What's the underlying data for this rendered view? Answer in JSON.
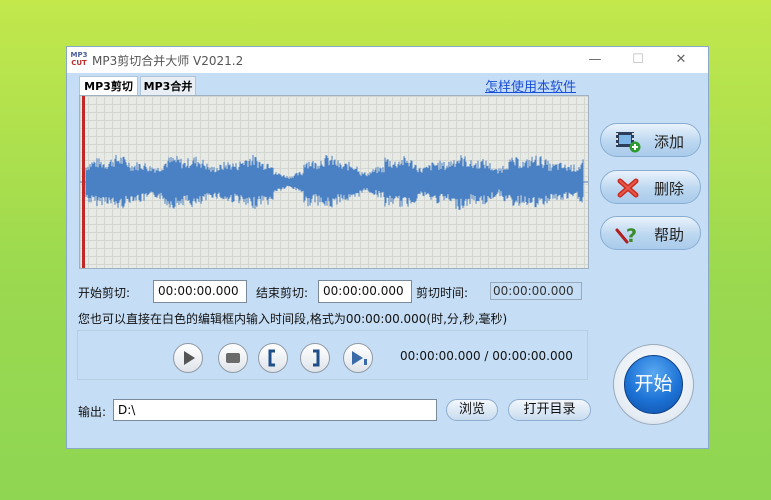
{
  "window": {
    "title": "MP3剪切合并大师 V2021.2",
    "logo_text_top": "MP3",
    "logo_text_bottom": "CUT"
  },
  "tabs": [
    {
      "label": "MP3剪切",
      "selected": true
    },
    {
      "label": "MP3合并",
      "selected": false
    }
  ],
  "help_link": "怎样使用本软件",
  "side_buttons": {
    "add": "添加",
    "delete": "删除",
    "help": "帮助"
  },
  "cut": {
    "start_label": "开始剪切:",
    "start_value": "00:00:00.000",
    "end_label": "结束剪切:",
    "end_value": "00:00:00.000",
    "duration_label": "剪切时间:",
    "duration_value": "00:00:00.000",
    "hint": "您也可以直接在白色的编辑框内输入时间段,格式为00:00:00.000(时,分,秒,毫秒)"
  },
  "playback": {
    "timecode": "00:00:00.000 / 00:00:00.000"
  },
  "start_button": "开始",
  "output": {
    "label": "输出:",
    "path": "D:\\",
    "browse": "浏览",
    "open_dir": "打开目录"
  },
  "colors": {
    "waveform": "#4a80c4",
    "cursor": "#c02828",
    "accent_blue": "#1d73d6",
    "link": "#1b4fd8"
  }
}
